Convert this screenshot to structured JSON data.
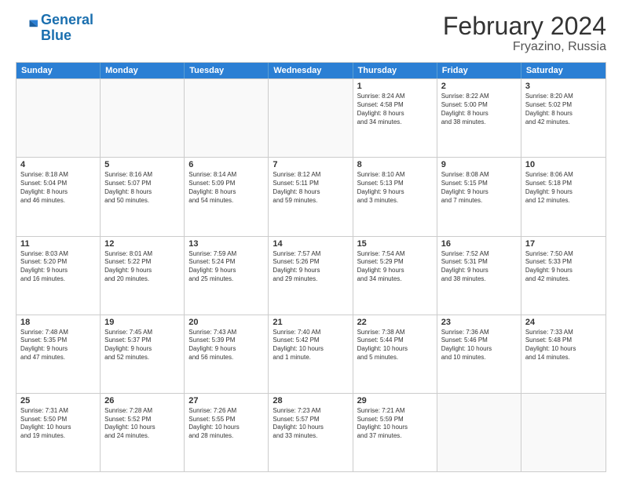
{
  "logo": {
    "line1": "General",
    "line2": "Blue"
  },
  "title": "February 2024",
  "subtitle": "Fryazino, Russia",
  "days_of_week": [
    "Sunday",
    "Monday",
    "Tuesday",
    "Wednesday",
    "Thursday",
    "Friday",
    "Saturday"
  ],
  "weeks": [
    [
      {
        "day": "",
        "info": ""
      },
      {
        "day": "",
        "info": ""
      },
      {
        "day": "",
        "info": ""
      },
      {
        "day": "",
        "info": ""
      },
      {
        "day": "1",
        "info": "Sunrise: 8:24 AM\nSunset: 4:58 PM\nDaylight: 8 hours\nand 34 minutes."
      },
      {
        "day": "2",
        "info": "Sunrise: 8:22 AM\nSunset: 5:00 PM\nDaylight: 8 hours\nand 38 minutes."
      },
      {
        "day": "3",
        "info": "Sunrise: 8:20 AM\nSunset: 5:02 PM\nDaylight: 8 hours\nand 42 minutes."
      }
    ],
    [
      {
        "day": "4",
        "info": "Sunrise: 8:18 AM\nSunset: 5:04 PM\nDaylight: 8 hours\nand 46 minutes."
      },
      {
        "day": "5",
        "info": "Sunrise: 8:16 AM\nSunset: 5:07 PM\nDaylight: 8 hours\nand 50 minutes."
      },
      {
        "day": "6",
        "info": "Sunrise: 8:14 AM\nSunset: 5:09 PM\nDaylight: 8 hours\nand 54 minutes."
      },
      {
        "day": "7",
        "info": "Sunrise: 8:12 AM\nSunset: 5:11 PM\nDaylight: 8 hours\nand 59 minutes."
      },
      {
        "day": "8",
        "info": "Sunrise: 8:10 AM\nSunset: 5:13 PM\nDaylight: 9 hours\nand 3 minutes."
      },
      {
        "day": "9",
        "info": "Sunrise: 8:08 AM\nSunset: 5:15 PM\nDaylight: 9 hours\nand 7 minutes."
      },
      {
        "day": "10",
        "info": "Sunrise: 8:06 AM\nSunset: 5:18 PM\nDaylight: 9 hours\nand 12 minutes."
      }
    ],
    [
      {
        "day": "11",
        "info": "Sunrise: 8:03 AM\nSunset: 5:20 PM\nDaylight: 9 hours\nand 16 minutes."
      },
      {
        "day": "12",
        "info": "Sunrise: 8:01 AM\nSunset: 5:22 PM\nDaylight: 9 hours\nand 20 minutes."
      },
      {
        "day": "13",
        "info": "Sunrise: 7:59 AM\nSunset: 5:24 PM\nDaylight: 9 hours\nand 25 minutes."
      },
      {
        "day": "14",
        "info": "Sunrise: 7:57 AM\nSunset: 5:26 PM\nDaylight: 9 hours\nand 29 minutes."
      },
      {
        "day": "15",
        "info": "Sunrise: 7:54 AM\nSunset: 5:29 PM\nDaylight: 9 hours\nand 34 minutes."
      },
      {
        "day": "16",
        "info": "Sunrise: 7:52 AM\nSunset: 5:31 PM\nDaylight: 9 hours\nand 38 minutes."
      },
      {
        "day": "17",
        "info": "Sunrise: 7:50 AM\nSunset: 5:33 PM\nDaylight: 9 hours\nand 42 minutes."
      }
    ],
    [
      {
        "day": "18",
        "info": "Sunrise: 7:48 AM\nSunset: 5:35 PM\nDaylight: 9 hours\nand 47 minutes."
      },
      {
        "day": "19",
        "info": "Sunrise: 7:45 AM\nSunset: 5:37 PM\nDaylight: 9 hours\nand 52 minutes."
      },
      {
        "day": "20",
        "info": "Sunrise: 7:43 AM\nSunset: 5:39 PM\nDaylight: 9 hours\nand 56 minutes."
      },
      {
        "day": "21",
        "info": "Sunrise: 7:40 AM\nSunset: 5:42 PM\nDaylight: 10 hours\nand 1 minute."
      },
      {
        "day": "22",
        "info": "Sunrise: 7:38 AM\nSunset: 5:44 PM\nDaylight: 10 hours\nand 5 minutes."
      },
      {
        "day": "23",
        "info": "Sunrise: 7:36 AM\nSunset: 5:46 PM\nDaylight: 10 hours\nand 10 minutes."
      },
      {
        "day": "24",
        "info": "Sunrise: 7:33 AM\nSunset: 5:48 PM\nDaylight: 10 hours\nand 14 minutes."
      }
    ],
    [
      {
        "day": "25",
        "info": "Sunrise: 7:31 AM\nSunset: 5:50 PM\nDaylight: 10 hours\nand 19 minutes."
      },
      {
        "day": "26",
        "info": "Sunrise: 7:28 AM\nSunset: 5:52 PM\nDaylight: 10 hours\nand 24 minutes."
      },
      {
        "day": "27",
        "info": "Sunrise: 7:26 AM\nSunset: 5:55 PM\nDaylight: 10 hours\nand 28 minutes."
      },
      {
        "day": "28",
        "info": "Sunrise: 7:23 AM\nSunset: 5:57 PM\nDaylight: 10 hours\nand 33 minutes."
      },
      {
        "day": "29",
        "info": "Sunrise: 7:21 AM\nSunset: 5:59 PM\nDaylight: 10 hours\nand 37 minutes."
      },
      {
        "day": "",
        "info": ""
      },
      {
        "day": "",
        "info": ""
      }
    ]
  ]
}
